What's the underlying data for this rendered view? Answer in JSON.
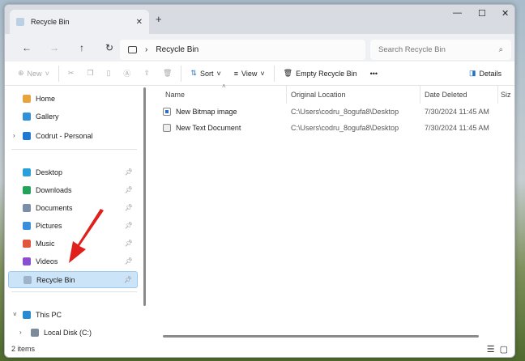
{
  "window": {
    "tab_title": "Recycle Bin",
    "minimize": "—",
    "maximize": "☐",
    "close": "✕",
    "new_tab": "+"
  },
  "nav": {
    "back": "←",
    "forward": "→",
    "up": "↑",
    "refresh": "↻",
    "breadcrumb": "Recycle Bin",
    "search_placeholder": "Search Recycle Bin"
  },
  "toolbar": {
    "new": "New",
    "sort": "Sort",
    "view": "View",
    "empty": "Empty Recycle Bin",
    "more": "•••",
    "details": "Details"
  },
  "sidebar": {
    "items": [
      {
        "label": "Home",
        "color": "#e8a33a"
      },
      {
        "label": "Gallery",
        "color": "#2f8fd8"
      },
      {
        "label": "Codrut - Personal",
        "color": "#1f78d1"
      },
      {
        "label": "Desktop",
        "color": "#2aa0d8"
      },
      {
        "label": "Downloads",
        "color": "#23a35a"
      },
      {
        "label": "Documents",
        "color": "#7b8da8"
      },
      {
        "label": "Pictures",
        "color": "#3a8fdc"
      },
      {
        "label": "Music",
        "color": "#e0563f"
      },
      {
        "label": "Videos",
        "color": "#8a4fd1"
      },
      {
        "label": "Recycle Bin",
        "color": "#9fb3c8"
      },
      {
        "label": "This PC",
        "color": "#2a8ad0"
      },
      {
        "label": "Local Disk (C:)",
        "color": "#7d8a99"
      }
    ]
  },
  "columns": [
    "Name",
    "Original Location",
    "Date Deleted",
    "Siz"
  ],
  "files": [
    {
      "name": "New Bitmap image",
      "location": "C:\\Users\\codru_8ogufa8\\Desktop",
      "date": "7/30/2024 11:45 AM"
    },
    {
      "name": "New Text Document",
      "location": "C:\\Users\\codru_8ogufa8\\Desktop",
      "date": "7/30/2024 11:45 AM"
    }
  ],
  "status": {
    "count": "2 items"
  }
}
